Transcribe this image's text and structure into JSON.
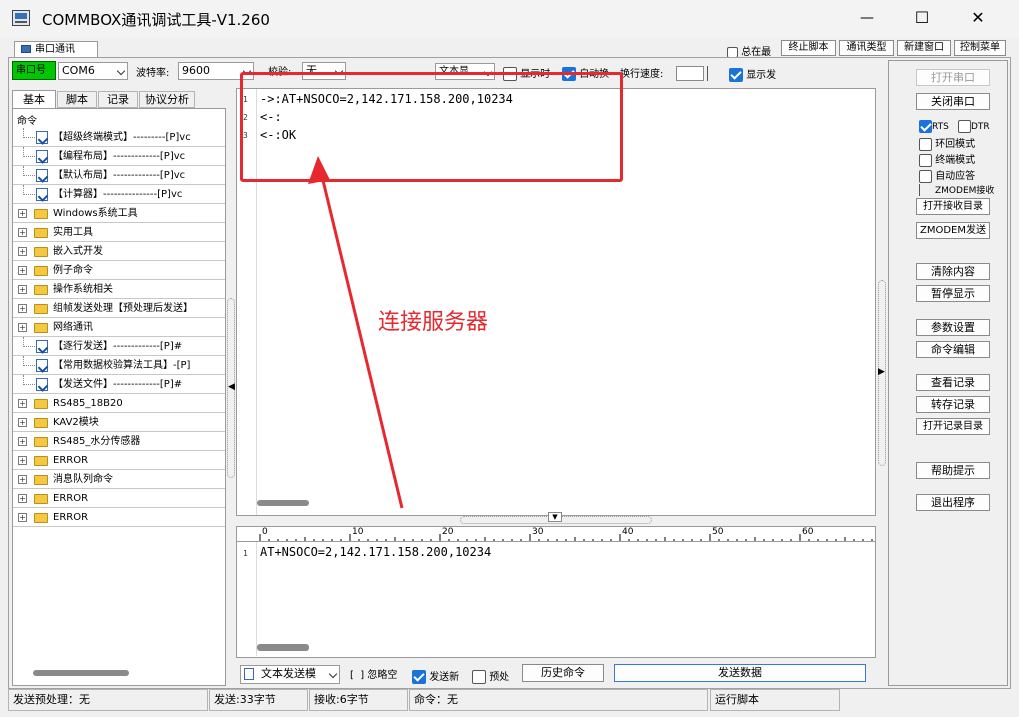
{
  "window": {
    "title": "COMMBOX通讯调试工具-V1.260",
    "controls": {
      "minimize": "—",
      "maximize": "☐",
      "close": "✕"
    }
  },
  "top_tab": "串口通讯",
  "top_right": {
    "always_top_label": "总在最",
    "buttons": [
      "终止脚本",
      "通讯类型",
      "新建窗口",
      "控制菜单"
    ]
  },
  "port_bar": {
    "port_button": "串口号",
    "port_value": "COM6",
    "baud_label": "波特率:",
    "baud_value": "9600",
    "parity_label": "校验:",
    "parity_value": "无"
  },
  "display_bar": {
    "mode_value": "文本显",
    "show_time_label": "显示时",
    "auto_wrap_label": "自动换",
    "line_speed_label": "换行速度:",
    "show_send_label": "显示发"
  },
  "left_tabs": [
    "基本",
    "脚本",
    "记录",
    "协议分析"
  ],
  "tree": {
    "root": "命令",
    "items": [
      {
        "text": "【超级终端模式】---------[P]vc",
        "kind": "file"
      },
      {
        "text": "【编程布局】-------------[P]vc",
        "kind": "file"
      },
      {
        "text": "【默认布局】-------------[P]vc",
        "kind": "file"
      },
      {
        "text": "【计算器】---------------[P]vc",
        "kind": "file"
      },
      {
        "text": "Windows系统工具",
        "kind": "folder"
      },
      {
        "text": "实用工具",
        "kind": "folder"
      },
      {
        "text": "嵌入式开发",
        "kind": "folder"
      },
      {
        "text": "例子命令",
        "kind": "folder"
      },
      {
        "text": "操作系统相关",
        "kind": "folder"
      },
      {
        "text": "组帧发送处理【预处理后发送】",
        "kind": "folder"
      },
      {
        "text": "网络通讯",
        "kind": "folder"
      },
      {
        "text": "【逐行发送】-------------[P]#",
        "kind": "file"
      },
      {
        "text": "【常用数据校验算法工具】-[P]",
        "kind": "file"
      },
      {
        "text": "【发送文件】-------------[P]#",
        "kind": "file"
      },
      {
        "text": "RS485_18B20",
        "kind": "folder"
      },
      {
        "text": "KAV2模块",
        "kind": "folder"
      },
      {
        "text": "RS485_水分传感器",
        "kind": "folder"
      },
      {
        "text": "ERROR",
        "kind": "folder"
      },
      {
        "text": "消息队列命令",
        "kind": "folder"
      },
      {
        "text": "ERROR",
        "kind": "folder"
      },
      {
        "text": "ERROR",
        "kind": "folder"
      }
    ]
  },
  "receive": {
    "lines": [
      {
        "num": "1",
        "text": "->:AT+NSOCO=2,142.171.158.200,10234"
      },
      {
        "num": "2",
        "text": "<-:"
      },
      {
        "num": "3",
        "text": "<-:OK"
      }
    ]
  },
  "annotation": "连接服务器",
  "ruler": [
    "0",
    "10",
    "20",
    "30",
    "40",
    "50",
    "60"
  ],
  "send": {
    "lines": [
      {
        "num": "1",
        "text": "AT+NSOCO=2,142.171.158.200,10234"
      }
    ]
  },
  "send_bar": {
    "mode_value": "文本发送模",
    "ignore_label": "忽略空",
    "send_new_label": "发送新",
    "preprocess_label": "预处",
    "history_button": "历史命令",
    "send_button": "发送数据"
  },
  "right_panel": {
    "open_port": "打开串口",
    "close_port": "关闭串口",
    "rts_label": "RTS",
    "dtr_label": "DTR",
    "loop_label": "环回模式",
    "terminal_label": "终端模式",
    "auto_reply_label": "自动应答",
    "zmodem_recv_label": "ZMODEM接收",
    "open_recv_dir": "打开接收目录",
    "zmodem_send": "ZMODEM发送",
    "clear": "清除内容",
    "pause": "暂停显示",
    "params": "参数设置",
    "cmd_edit": "命令编辑",
    "view_log": "查看记录",
    "save_log": "转存记录",
    "open_log_dir": "打开记录目录",
    "help": "帮助提示",
    "exit": "退出程序"
  },
  "status": {
    "preprocess": "发送预处理：无",
    "sent": "发送:33字节",
    "received": "接收:6字节",
    "command": "命令：无",
    "script": "运行脚本"
  },
  "colors": {
    "port_button_bg": "#00c800",
    "annotation_red": "#e5292f",
    "checkbox_blue": "#1a73d9"
  }
}
